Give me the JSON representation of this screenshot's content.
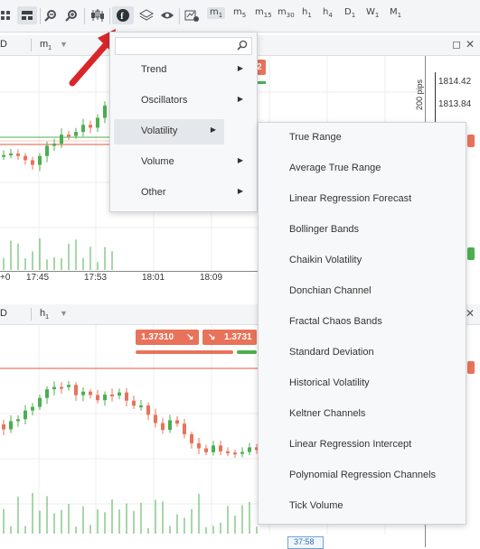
{
  "toolbar": {
    "timeframes": [
      {
        "base": "m",
        "sub": "1",
        "active": true
      },
      {
        "base": "m",
        "sub": "5"
      },
      {
        "base": "m",
        "sub": "15"
      },
      {
        "base": "m",
        "sub": "30"
      },
      {
        "base": "h",
        "sub": "1"
      },
      {
        "base": "h",
        "sub": "4"
      },
      {
        "base": "D",
        "sub": "1"
      },
      {
        "base": "W",
        "sub": "1"
      },
      {
        "base": "M",
        "sub": "1"
      }
    ]
  },
  "top_panel": {
    "symbol": "D",
    "timeframe_base": "m",
    "timeframe_sub": "1",
    "price_labels": [
      "1814.42",
      "1813.84"
    ],
    "pips_label": "200 pips",
    "time_labels": [
      "+0",
      "17:45",
      "17:53",
      "18:01",
      "18:09"
    ],
    "badge_fragment": "2"
  },
  "bottom_panel": {
    "symbol": "D",
    "timeframe_base": "h",
    "timeframe_sub": "1",
    "bid_badge": "1.37310",
    "ask_badge": "1.3731",
    "time_badge": "37:58"
  },
  "indicator_menu": {
    "search_placeholder": "",
    "categories": [
      "Trend",
      "Oscillators",
      "Volatility",
      "Volume",
      "Other"
    ],
    "selected": "Volatility"
  },
  "volatility_submenu": [
    "True Range",
    "Average True Range",
    "Linear Regression Forecast",
    "Bollinger Bands",
    "Chaikin Volatility",
    "Donchian Channel",
    "Fractal Chaos Bands",
    "Standard Deviation",
    "Historical Volatility",
    "Keltner Channels",
    "Linear Regression Intercept",
    "Polynomial Regression Channels",
    "Tick Volume"
  ],
  "colors": {
    "bull": "#4caf50",
    "bear": "#e8735a",
    "arrow": "#d9262b",
    "level_line": "#e05a3a"
  }
}
